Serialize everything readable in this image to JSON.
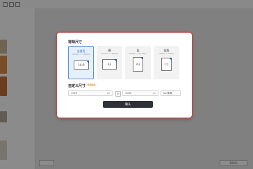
{
  "modal": {
    "section_common": "常规尺寸",
    "section_custom": "自定义尺寸",
    "custom_badge": "开通会员",
    "confirm_label": "确认",
    "cards": [
      {
        "name": "全部页",
        "dims": "1920px × 1080px",
        "ratio": "16:9",
        "selected": true
      },
      {
        "name": "横",
        "dims": "1191px × 842px",
        "ratio": "A3"
      },
      {
        "name": "竖",
        "dims": "842px × 1191px",
        "ratio": "A3"
      },
      {
        "name": "竖版",
        "dims": "780px × 780px",
        "ratio": "1:1"
      }
    ],
    "custom": {
      "width_value": "1920",
      "height_value": "1080",
      "unit": "px",
      "link_symbol": "⇔",
      "unit_select": "px/像素"
    }
  },
  "background": {
    "zoom": "100%"
  },
  "colors": {
    "accent": "#5b8fe0",
    "modal_border": "#b4534c",
    "confirm_bg": "#2e3238"
  }
}
